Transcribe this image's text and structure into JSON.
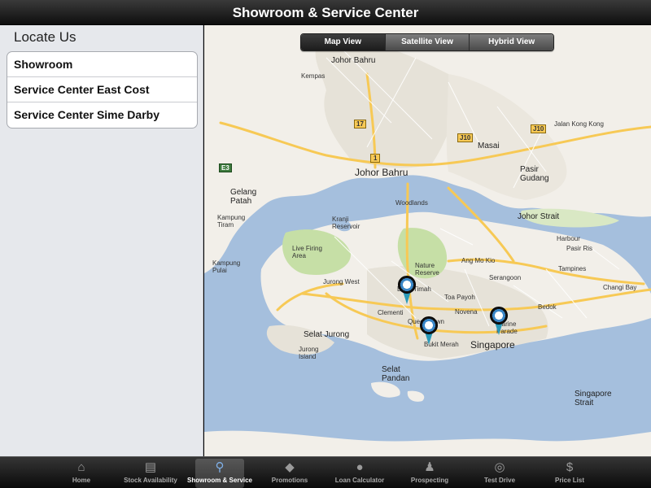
{
  "header": {
    "title": "Showroom & Service Center"
  },
  "sidebar": {
    "heading": "Locate Us",
    "items": [
      {
        "label": "Showroom"
      },
      {
        "label": "Service Center East Cost"
      },
      {
        "label": "Service Center Sime Darby"
      }
    ]
  },
  "map": {
    "view_toggle": [
      {
        "label": "Map View",
        "selected": true
      },
      {
        "label": "Satellite View",
        "selected": false
      },
      {
        "label": "Hybrid View",
        "selected": false
      }
    ],
    "labels": {
      "johor_bahru_big": "Johor Bahru",
      "johor_bahru_small": "Johor Bahru",
      "singapore": "Singapore",
      "pasir_gudang": "Pasir\nGudang",
      "masai": "Masai",
      "gelang_patah": "Gelang\nPatah",
      "kempas": "Kempas",
      "woodlands": "Woodlands",
      "kranji_reservoir": "Kranji\nReservoir",
      "live_firing_area": "Live Firing\nArea",
      "nature_reserve": "Nature\nReserve",
      "bukit_timah": "Bukit Timah",
      "jurong_west": "Jurong West",
      "jurong_island": "Jurong\nIsland",
      "selat_jurong": "Selat Jurong",
      "selat_pandan": "Selat\nPandan",
      "singapore_strait": "Singapore\nStrait",
      "johor_strait": "Johor Strait",
      "jalan_kong_kong": "Jalan Kong Kong",
      "ang_mo_kio": "Ang Mo Kio",
      "bedok": "Bedok",
      "clementi": "Clementi",
      "queenstown": "Queenstown",
      "bukit_merah": "Bukit Merah",
      "novena": "Novena",
      "marine_parade": "Marine\nParade",
      "toa_payoh": "Toa Payoh",
      "serangoon": "Serangoon",
      "tampines": "Tampines",
      "pasir_ris": "Pasir Ris",
      "changi_bay": "Changi Bay",
      "kampung_tiram": "Kampung\nTiram",
      "kampung_pulai": "Kampung\nPulai",
      "harbour": "Harbour",
      "route_1": "1",
      "route_17": "17",
      "route_j10": "J10",
      "route_j10b": "J10",
      "route_e3": "E3"
    },
    "pins": [
      {
        "name": "bmw-pin-bukit-timah"
      },
      {
        "name": "bmw-pin-bukit-merah"
      },
      {
        "name": "bmw-pin-marine-parade"
      }
    ]
  },
  "tabbar": {
    "tabs": [
      {
        "label": "Home",
        "icon": "home-icon"
      },
      {
        "label": "Stock Availability",
        "icon": "document-icon"
      },
      {
        "label": "Showroom & Service",
        "icon": "magnifier-icon",
        "active": true
      },
      {
        "label": "Promotions",
        "icon": "tag-icon"
      },
      {
        "label": "Loan Calculator",
        "icon": "chat-bubble-icon"
      },
      {
        "label": "Prospecting",
        "icon": "person-icon"
      },
      {
        "label": "Test Drive",
        "icon": "steering-wheel-icon"
      },
      {
        "label": "Price List",
        "icon": "dollar-icon"
      }
    ]
  },
  "colors": {
    "water": "#a5bfdd",
    "land": "#f2efe9",
    "park": "#c6dfa6",
    "urban": "#e6e2d8",
    "road_major": "#f7c955",
    "accent_blue": "#3a87c7"
  }
}
